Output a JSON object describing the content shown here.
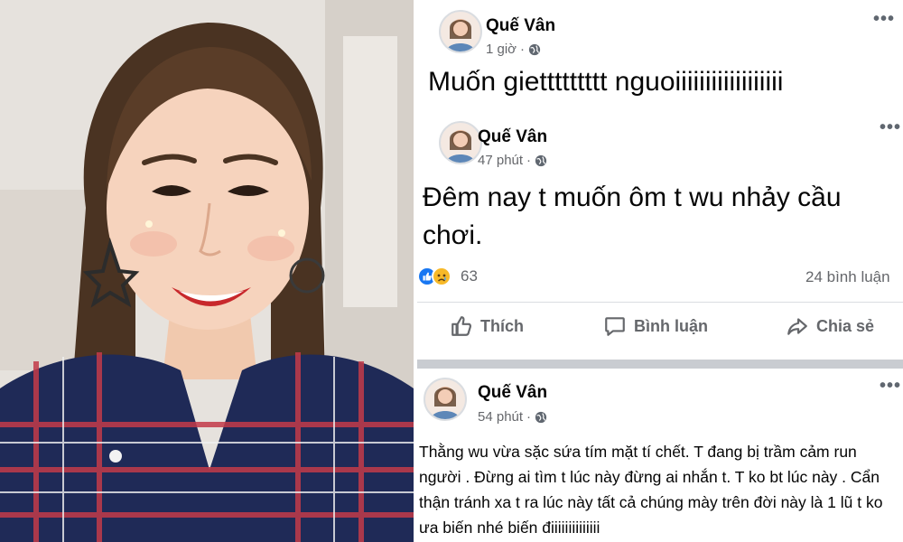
{
  "posts": [
    {
      "author": "Quế Vân",
      "time": "1 giờ",
      "text": "Muốn giettttttttt nguoiiiiiiiiiiiiiiiiii"
    },
    {
      "author": "Quế Vân",
      "time": "47 phút",
      "text": "Đêm nay t muốn ôm t wu nhảy cầu chơi.",
      "reaction_count": "63",
      "comment_count": "24 bình luận",
      "actions": [
        "Thích",
        "Bình luận",
        "Chia sẻ"
      ]
    },
    {
      "author": "Quế Vân",
      "time": "54 phút",
      "text": "Thằng wu vừa sặc sứa tím mặt tí chết. T đang bị trầm cảm run người . Đừng ai tìm t lúc này đừng ai nhắn t. T ko bt lúc này . Cẩn thận tránh xa t ra lúc này tất cả chúng mày trên đời này là 1 lũ t ko ưa  biến nhé biến điiiiiiiiiiiiii"
    }
  ],
  "icons": {
    "privacy": "globe-icon",
    "more": "more-options-icon",
    "like": "thumbs-up-icon",
    "comment": "comment-icon",
    "share": "share-icon"
  },
  "colors": {
    "facebook_blue": "#1877f2",
    "secondary_text": "#65676b",
    "divider": "#c9ccd1"
  }
}
